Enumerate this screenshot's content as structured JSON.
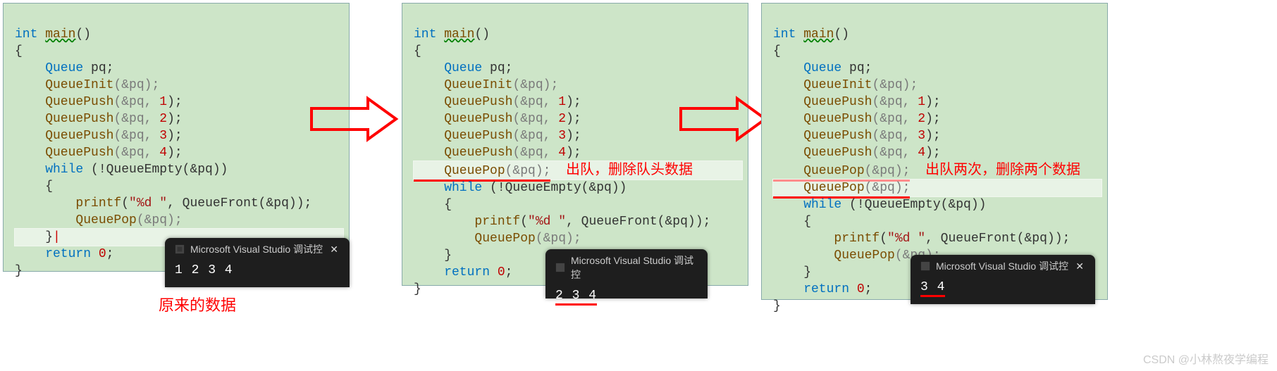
{
  "panel1": {
    "sig_type": "int",
    "sig_name": "main",
    "sig_tail": "()",
    "brace_open": "{",
    "decl": "    Queue pq;",
    "init": "    QueueInit",
    "init_arg": "(&pq);",
    "push1": "    QueuePush",
    "push1_arg": "(&pq, ",
    "push1_num": "1",
    "push1_tail": ");",
    "push2": "    QueuePush",
    "push2_arg": "(&pq, ",
    "push2_num": "2",
    "push2_tail": ");",
    "push3": "    QueuePush",
    "push3_arg": "(&pq, ",
    "push3_num": "3",
    "push3_tail": ");",
    "push4": "    QueuePush",
    "push4_arg": "(&pq, ",
    "push4_num": "4",
    "push4_tail": ");",
    "while_kw": "    while ",
    "while_cond": "(!QueueEmpty(&pq))",
    "brace2": "    {",
    "printf": "        printf",
    "printf_open": "(",
    "printf_fmt": "\"%d \"",
    "printf_mid": ", QueueFront(&pq));",
    "pop": "        QueuePop",
    "pop_arg": "(&pq);",
    "brace2c": "    }",
    "ret_kw": "    return ",
    "ret_num": "0",
    "ret_tail": ";",
    "brace_close": "}",
    "console_title": "Microsoft Visual Studio 调试控",
    "console_out": "1 2 3 4",
    "caption": "原来的数据"
  },
  "panel2": {
    "sig_type": "int",
    "sig_name": "main",
    "sig_tail": "()",
    "brace_open": "{",
    "decl": "    Queue pq;",
    "init": "    QueueInit",
    "init_arg": "(&pq);",
    "push1": "    QueuePush",
    "push1_arg": "(&pq, ",
    "push1_num": "1",
    "push1_tail": ");",
    "push2": "    QueuePush",
    "push2_arg": "(&pq, ",
    "push2_num": "2",
    "push2_tail": ");",
    "push3": "    QueuePush",
    "push3_arg": "(&pq, ",
    "push3_num": "3",
    "push3_tail": ");",
    "push4": "    QueuePush",
    "push4_arg": "(&pq, ",
    "push4_num": "4",
    "push4_tail": ");",
    "popA": "    QueuePop",
    "popA_arg": "(&pq);",
    "annotA": "出队，删除队头数据",
    "while_kw": "    while ",
    "while_cond": "(!QueueEmpty(&pq))",
    "brace2": "    {",
    "printf": "        printf",
    "printf_open": "(",
    "printf_fmt": "\"%d \"",
    "printf_mid": ", QueueFront(&pq));",
    "pop": "        QueuePop",
    "pop_arg": "(&pq);",
    "brace2c": "    }",
    "ret_kw": "    return ",
    "ret_num": "0",
    "ret_tail": ";",
    "brace_close": "}",
    "console_title": "Microsoft Visual Studio 调试控",
    "console_out": "2 3 4"
  },
  "panel3": {
    "sig_type": "int",
    "sig_name": "main",
    "sig_tail": "()",
    "brace_open": "{",
    "decl": "    Queue pq;",
    "init": "    QueueInit",
    "init_arg": "(&pq);",
    "push1": "    QueuePush",
    "push1_arg": "(&pq, ",
    "push1_num": "1",
    "push1_tail": ");",
    "push2": "    QueuePush",
    "push2_arg": "(&pq, ",
    "push2_num": "2",
    "push2_tail": ");",
    "push3": "    QueuePush",
    "push3_arg": "(&pq, ",
    "push3_num": "3",
    "push3_tail": ");",
    "push4": "    QueuePush",
    "push4_arg": "(&pq, ",
    "push4_num": "4",
    "push4_tail": ");",
    "popA": "    QueuePop",
    "popA_arg": "(&pq);",
    "annotA": "出队两次，删除两个数据",
    "popB": "    QueuePop",
    "popB_arg": "(&pq);",
    "while_kw": "    while ",
    "while_cond": "(!QueueEmpty(&pq))",
    "brace2": "    {",
    "printf": "        printf",
    "printf_open": "(",
    "printf_fmt": "\"%d \"",
    "printf_mid": ", QueueFront(&pq));",
    "pop": "        QueuePop",
    "pop_arg": "(&pq);",
    "brace2c": "    }",
    "ret_kw": "    return ",
    "ret_num": "0",
    "ret_tail": ";",
    "brace_close": "}",
    "console_title": "Microsoft Visual Studio 调试控",
    "console_out": "3 4"
  },
  "watermark": "CSDN @小林熬夜学编程"
}
